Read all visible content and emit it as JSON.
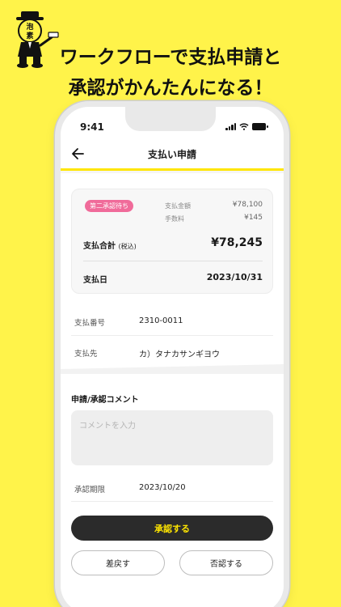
{
  "headline": {
    "line1": "ワークフローで支払申請と",
    "line2": "承認がかんたんになる！"
  },
  "mascot": {
    "chars": [
      "泡",
      "素"
    ]
  },
  "status_bar": {
    "time": "9:41"
  },
  "nav": {
    "title": "支払い申請",
    "back_icon": "arrow-left-icon"
  },
  "summary": {
    "status_badge": "第二承認待ち",
    "amount_label": "支払金額",
    "amount_value": "¥78,100",
    "fee_label": "手数料",
    "fee_value": "¥145",
    "total_label": "支払合計",
    "total_note": "(税込)",
    "total_value": "¥78,245",
    "date_label": "支払日",
    "date_value": "2023/10/31"
  },
  "details": {
    "number_label": "支払番号",
    "number_value": "2310-0011",
    "payee_label": "支払先",
    "payee_value": "カ）タナカサンギヨウ"
  },
  "comment": {
    "title": "申請/承認コメント",
    "placeholder": "コメントを入力",
    "value": ""
  },
  "deadline": {
    "label": "承認期限",
    "value": "2023/10/20"
  },
  "actions": {
    "approve_label": "承認する",
    "return_label": "差戻す",
    "reject_label": "否認する"
  },
  "colors": {
    "background": "#FFF34A",
    "accent": "#FFE600",
    "badge": "#f06b9a",
    "primary_button": "#2b2b2b"
  }
}
